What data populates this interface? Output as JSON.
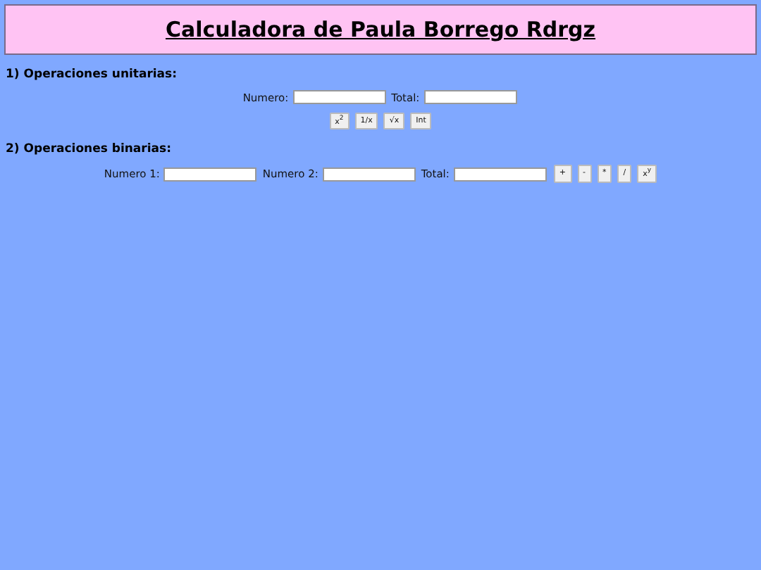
{
  "header": {
    "title": "Calculadora de Paula Borrego Rdrgz"
  },
  "sections": [
    {
      "heading": "1) Operaciones unitarias:",
      "kind": "stacked",
      "fields": [
        {
          "label": "Numero:"
        },
        {
          "label": "Total:"
        }
      ],
      "buttons": [
        "x$^{2}$",
        "1/x",
        "√x",
        "Int"
      ]
    },
    {
      "heading": "2) Operaciones binarias:",
      "kind": "inline",
      "fields": [
        {
          "label": "Numero 1:"
        },
        {
          "label": "Numero 2:"
        },
        {
          "label": "Total:"
        }
      ],
      "buttons": [
        "+",
        "-",
        "*",
        "/",
        "x$^{y}$"
      ]
    }
  ]
}
